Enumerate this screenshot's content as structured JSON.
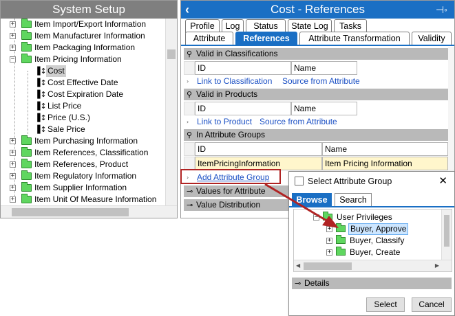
{
  "left_panel": {
    "title": "System Setup",
    "tree": [
      {
        "label": "Item Import/Export Information",
        "type": "folder"
      },
      {
        "label": "Item Manufacturer Information",
        "type": "folder"
      },
      {
        "label": "Item Packaging Information",
        "type": "folder"
      },
      {
        "label": "Item Pricing Information",
        "type": "folder",
        "expanded": true
      },
      {
        "label": "Cost",
        "type": "attribute",
        "selected": true
      },
      {
        "label": "Cost Effective Date",
        "type": "attribute"
      },
      {
        "label": "Cost Expiration Date",
        "type": "attribute"
      },
      {
        "label": "List Price",
        "type": "attribute"
      },
      {
        "label": "Price (U.S.)",
        "type": "attribute"
      },
      {
        "label": "Sale Price",
        "type": "attribute"
      },
      {
        "label": "Item Purchasing Information",
        "type": "folder"
      },
      {
        "label": "Item References, Classification",
        "type": "folder"
      },
      {
        "label": "Item References, Product",
        "type": "folder"
      },
      {
        "label": "Item Regulatory Information",
        "type": "folder"
      },
      {
        "label": "Item Supplier Information",
        "type": "folder"
      },
      {
        "label": "Item Unit Of Measure Information",
        "type": "folder"
      }
    ]
  },
  "right_panel": {
    "title": "Cost - References",
    "tabs_row1": [
      "Profile",
      "Log",
      "Status",
      "State Log",
      "Tasks"
    ],
    "tabs_row2": [
      "Attribute",
      "References",
      "Attribute Transformation",
      "Validity"
    ],
    "active_tab": "References",
    "sections": {
      "classifications": {
        "title": "Valid in Classifications",
        "col_id": "ID",
        "col_name": "Name",
        "link1": "Link to Classification",
        "link2": "Source from Attribute"
      },
      "products": {
        "title": "Valid in Products",
        "col_id": "ID",
        "col_name": "Name",
        "link1": "Link to Product",
        "link2": "Source from Attribute"
      },
      "attribute_groups": {
        "title": "In Attribute Groups",
        "col_id": "ID",
        "col_name": "Name",
        "row_id": "ItemPricingInformation",
        "row_name": "Item Pricing Information",
        "add_link": "Add Attribute Group"
      },
      "values_for_attribute": "Values for Attribute",
      "value_distribution": "Value Distribution"
    }
  },
  "dialog": {
    "title": "Select Attribute Group",
    "tabs": [
      "Browse",
      "Search"
    ],
    "active_tab": "Browse",
    "tree": [
      {
        "label": "User Privileges",
        "expanded": true
      },
      {
        "label": "Buyer, Approve",
        "selected": true
      },
      {
        "label": "Buyer, Classify"
      },
      {
        "label": "Buyer, Create"
      }
    ],
    "details": "Details",
    "select_label": "Select",
    "cancel_label": "Cancel"
  },
  "colors": {
    "accent": "#1a6fc4",
    "highlight_box": "#b02323",
    "folder": "#5fd65f",
    "section_bg": "#b9b9b9",
    "row_highlight": "#fff6cc"
  }
}
